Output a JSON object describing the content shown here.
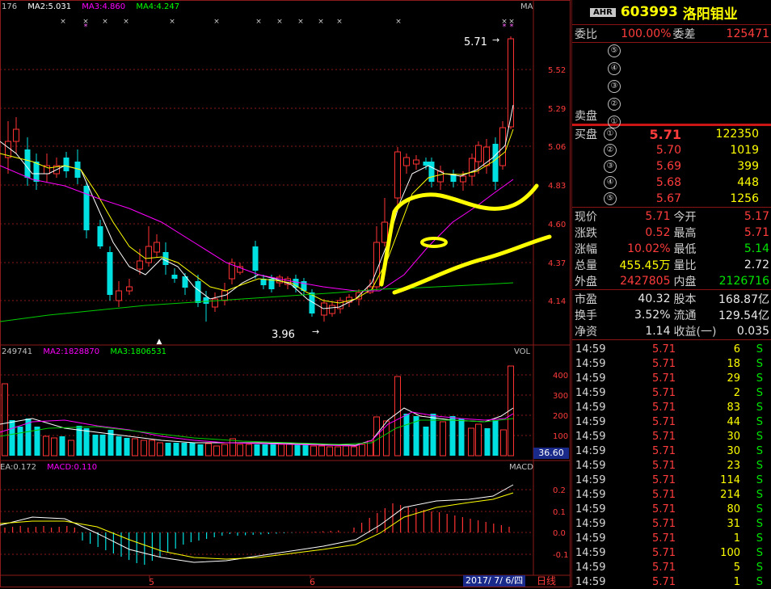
{
  "main_chart": {
    "ma_labels": [
      "176",
      "MA2:5.031",
      "MA3:4.860",
      "MA4:4.247"
    ],
    "indicator_name": "MA",
    "y_axis_ticks": [
      "5.52",
      "5.29",
      "5.06",
      "4.83",
      "4.60",
      "4.37",
      "4.14"
    ],
    "high_annotation": "5.71",
    "low_annotation": "3.96"
  },
  "volume_chart": {
    "ma_labels": [
      "249741",
      "MA2:1828870",
      "MA3:1806531"
    ],
    "indicator_name": "VOL",
    "y_axis_ticks": [
      "400",
      "300",
      "200",
      "100"
    ],
    "current_value": "36.60"
  },
  "macd_chart": {
    "labels": [
      "EA:0.172",
      "MACD:0.110"
    ],
    "indicator_name": "MACD",
    "y_axis_ticks": [
      "0.2",
      "0.1",
      "0.0",
      "-0.1"
    ]
  },
  "x_axis": {
    "month_labels": [
      "5",
      "6"
    ],
    "date_label": "2017/ 7/ 6/四",
    "period_label": "日线"
  },
  "quote": {
    "badge": "AHR",
    "code": "603993",
    "name": "洛阳钼业",
    "weibi_label": "委比",
    "weibi_value": "100.00%",
    "weicha_label": "委差",
    "weicha_value": "125471",
    "sell_label": "卖盘",
    "buy_label": "买盘",
    "sell_levels": [
      "⑤",
      "④",
      "③",
      "②",
      "①"
    ],
    "buy_levels": [
      {
        "level": "①",
        "price": "5.71",
        "vol": "122350"
      },
      {
        "level": "②",
        "price": "5.70",
        "vol": "1019"
      },
      {
        "level": "③",
        "price": "5.69",
        "vol": "399"
      },
      {
        "level": "④",
        "price": "5.68",
        "vol": "448"
      },
      {
        "level": "⑤",
        "price": "5.67",
        "vol": "1256"
      }
    ],
    "stats": [
      {
        "l1": "现价",
        "v1": "5.71",
        "c1": "red",
        "l2": "今开",
        "v2": "5.17",
        "c2": "red"
      },
      {
        "l1": "涨跌",
        "v1": "0.52",
        "c1": "red",
        "l2": "最高",
        "v2": "5.71",
        "c2": "red"
      },
      {
        "l1": "涨幅",
        "v1": "10.02%",
        "c1": "red",
        "l2": "最低",
        "v2": "5.14",
        "c2": "green"
      },
      {
        "l1": "总量",
        "v1": "455.45万",
        "c1": "yellow",
        "l2": "量比",
        "v2": "2.72",
        "c2": "white"
      },
      {
        "l1": "外盘",
        "v1": "2427805",
        "c1": "red",
        "l2": "内盘",
        "v2": "2126716",
        "c2": "green"
      }
    ],
    "fund": [
      {
        "l1": "市盈",
        "v1": "40.32",
        "l2": "股本",
        "v2": "168.87亿"
      },
      {
        "l1": "换手",
        "v1": "3.52%",
        "l2": "流通",
        "v2": "129.54亿"
      },
      {
        "l1": "净资",
        "v1": "1.14",
        "l2": "收益(一)",
        "v2": "0.035"
      }
    ],
    "ticks": [
      {
        "time": "14:59",
        "price": "5.71",
        "vol": "6",
        "side": "S"
      },
      {
        "time": "14:59",
        "price": "5.71",
        "vol": "18",
        "side": "S"
      },
      {
        "time": "14:59",
        "price": "5.71",
        "vol": "29",
        "side": "S"
      },
      {
        "time": "14:59",
        "price": "5.71",
        "vol": "2",
        "side": "S"
      },
      {
        "time": "14:59",
        "price": "5.71",
        "vol": "83",
        "side": "S"
      },
      {
        "time": "14:59",
        "price": "5.71",
        "vol": "44",
        "side": "S"
      },
      {
        "time": "14:59",
        "price": "5.71",
        "vol": "30",
        "side": "S"
      },
      {
        "time": "14:59",
        "price": "5.71",
        "vol": "30",
        "side": "S"
      },
      {
        "time": "14:59",
        "price": "5.71",
        "vol": "23",
        "side": "S"
      },
      {
        "time": "14:59",
        "price": "5.71",
        "vol": "114",
        "side": "S"
      },
      {
        "time": "14:59",
        "price": "5.71",
        "vol": "214",
        "side": "S"
      },
      {
        "time": "14:59",
        "price": "5.71",
        "vol": "80",
        "side": "S"
      },
      {
        "time": "14:59",
        "price": "5.71",
        "vol": "31",
        "side": "S"
      },
      {
        "time": "14:59",
        "price": "5.71",
        "vol": "1",
        "side": "S"
      },
      {
        "time": "14:59",
        "price": "5.71",
        "vol": "100",
        "side": "S"
      },
      {
        "time": "14:59",
        "price": "5.71",
        "vol": "5",
        "side": "S"
      },
      {
        "time": "14:59",
        "price": "5.71",
        "vol": "1",
        "side": "S"
      }
    ]
  },
  "colors": {
    "up": "#ff3232",
    "down": "#00e0e0",
    "ma2": "#ffffff",
    "ma3": "#ffff00",
    "ma4": "#ff00ff",
    "ma5": "#00cc00",
    "grid": "#8b1a1a",
    "annotation": "#ffff00"
  }
}
